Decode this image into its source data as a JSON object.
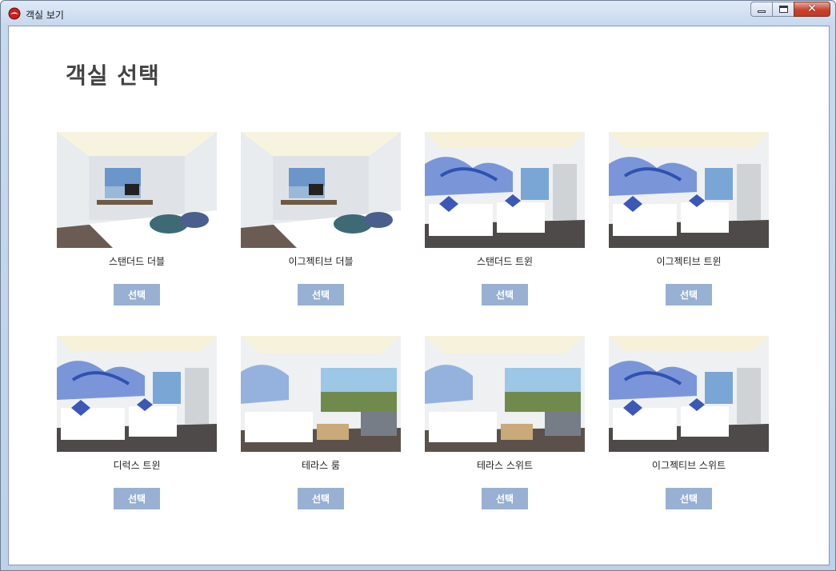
{
  "window": {
    "title": "객실 보기",
    "close_glyph": "✕"
  },
  "page": {
    "title": "객실 선택"
  },
  "select_label": "선택",
  "rooms": [
    {
      "name": "스탠더드 더블",
      "style": "double"
    },
    {
      "name": "이그젝티브 더블",
      "style": "double"
    },
    {
      "name": "스탠더드 트윈",
      "style": "mural"
    },
    {
      "name": "이그젝티브 트윈",
      "style": "mural"
    },
    {
      "name": "디럭스 트윈",
      "style": "mural"
    },
    {
      "name": "테라스 룸",
      "style": "terrace"
    },
    {
      "name": "테라스 스위트",
      "style": "terrace"
    },
    {
      "name": "이그젝티브 스위트",
      "style": "mural"
    }
  ],
  "colors": {
    "button": "#98b1d3",
    "title": "#444444"
  }
}
